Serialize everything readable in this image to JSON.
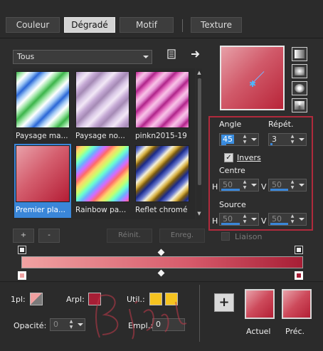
{
  "tabs": [
    {
      "label": "Couleur",
      "active": false
    },
    {
      "label": "Dégradé",
      "active": true
    },
    {
      "label": "Motif",
      "active": false
    },
    {
      "label": "Texture",
      "active": false
    }
  ],
  "category_select": {
    "value": "Tous"
  },
  "toolbar_icons": [
    "library-icon",
    "arrow-right-icon"
  ],
  "presets": [
    {
      "label": "Paysage ma..."
    },
    {
      "label": "Paysage no..."
    },
    {
      "label": "pinkn2015-19"
    },
    {
      "label": "Premier pla...",
      "selected": true
    },
    {
      "label": "Rainbow pa..."
    },
    {
      "label": "Reflet chromé"
    }
  ],
  "properties": {
    "angle_label": "Angle",
    "angle_value": "45",
    "repeat_label": "Répét.",
    "repeat_value": "3",
    "invert_label": "Invers",
    "invert_checked": true,
    "center_label": "Centre",
    "center_h_label": "H",
    "center_h_value": "50",
    "center_v_label": "V",
    "center_v_value": "50",
    "source_label": "Source",
    "source_h_label": "H",
    "source_h_value": "50",
    "source_v_label": "V",
    "source_v_value": "50"
  },
  "stop_controls": {
    "add_label": "+",
    "remove_label": "-",
    "reset_label": "Réinit.",
    "save_label": "Enreg.",
    "link_label": "Liaison"
  },
  "bottom": {
    "fg_label": "1pl:",
    "bg_label": "Arpl:",
    "user_label": "Util.:",
    "opacity_label": "Opacité:",
    "opacity_value": "0",
    "location_label": "Empl.:",
    "location_value": "0",
    "current_label": "Actuel",
    "previous_label": "Préc.",
    "add_swatch_label": "+"
  },
  "colors": {
    "accent_blue": "#3a86d8",
    "highlight_red": "#b02a3c",
    "gradient_start": "#f0a2a2",
    "gradient_end": "#a71e35",
    "user_color": "#f5c320"
  }
}
